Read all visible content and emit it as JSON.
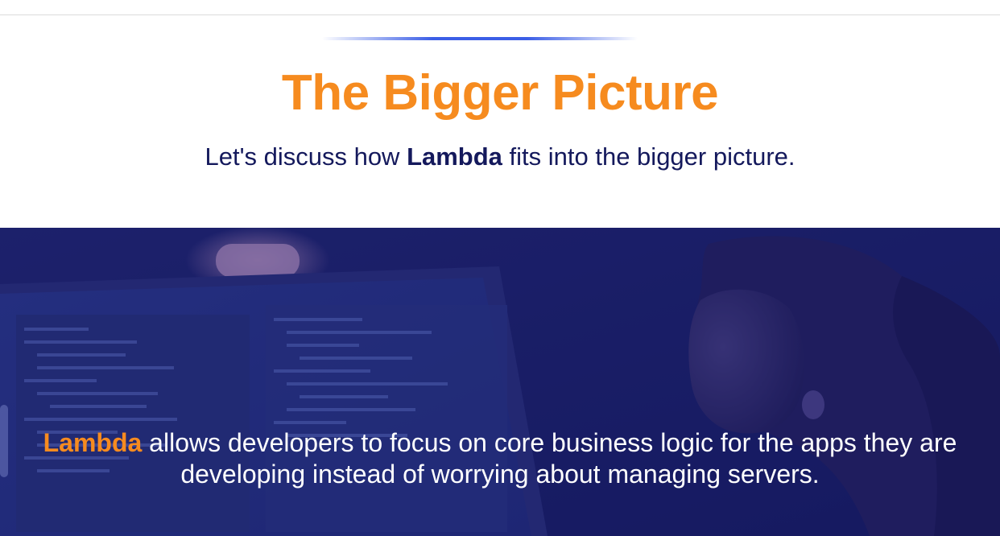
{
  "header": {
    "title": "The Bigger Picture",
    "subtitle_prefix": "Let's discuss how ",
    "subtitle_bold": "Lambda",
    "subtitle_suffix": " fits into the bigger picture."
  },
  "banner": {
    "highlight": "Lambda",
    "text": " allows developers to focus on core business logic for the apps they are developing instead of worrying about managing servers.",
    "image": "developer-at-monitor-photo"
  },
  "colors": {
    "accent": "#f68b1f",
    "navy": "#14195c",
    "line_blue": "#3b5ee6",
    "banner_bg": "#1b1f63"
  }
}
